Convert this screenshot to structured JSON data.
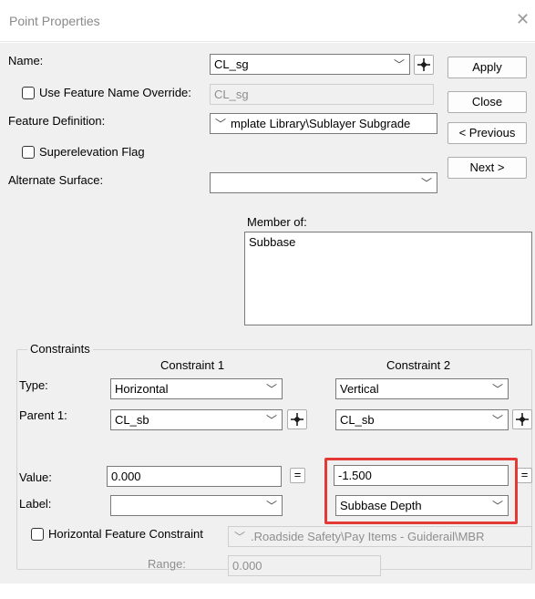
{
  "window": {
    "title": "Point Properties",
    "close_glyph": "✕"
  },
  "name": {
    "label": "Name:",
    "value": "CL_sg"
  },
  "feature_name_override": {
    "label": "Use Feature Name Override:",
    "value": "CL_sg",
    "checked": false
  },
  "feature_definition": {
    "label": "Feature Definition:",
    "value": "mplate Library\\Sublayer Subgrade"
  },
  "superelevation": {
    "label": "Superelevation Flag",
    "checked": false
  },
  "alternate_surface": {
    "label": "Alternate Surface:",
    "value": ""
  },
  "buttons": {
    "apply": "Apply",
    "close": "Close",
    "previous": "< Previous",
    "next": "Next >"
  },
  "member_of": {
    "label": "Member of:",
    "items": [
      "Subbase"
    ]
  },
  "constraints": {
    "group_label": "Constraints",
    "constraint1_header": "Constraint 1",
    "constraint2_header": "Constraint 2",
    "type_label": "Type:",
    "parent1_label": "Parent 1:",
    "value_label": "Value:",
    "label_label": "Label:",
    "c1": {
      "type": "Horizontal",
      "parent1": "CL_sb",
      "value": "0.000",
      "label": ""
    },
    "c2": {
      "type": "Vertical",
      "parent1": "CL_sb",
      "value": "-1.500",
      "label": "Subbase Depth"
    },
    "eq_glyph": "=",
    "horizontal_feature": {
      "label": "Horizontal Feature Constraint",
      "value": ".Roadside Safety\\Pay Items - Guiderail\\MBR",
      "checked": false
    },
    "range": {
      "label": "Range:",
      "value": "0.000"
    }
  },
  "colors": {
    "highlight": "#e53935",
    "dialog_bg": "#f0f0f0"
  },
  "icons": {
    "dropdown": "chevron-down-icon",
    "pick": "crosshair-pick-icon"
  }
}
